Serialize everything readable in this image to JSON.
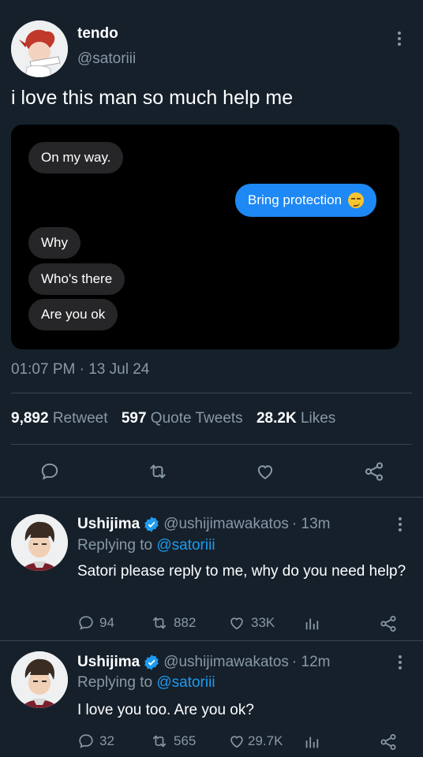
{
  "tweet": {
    "author_name": "tendo",
    "author_handle": "@satoriii",
    "text": "i love this man so much help me",
    "timestamp": "01:07 PM · 13 Jul 24",
    "stats": {
      "retweets_num": "9,892",
      "retweets_label": "Retweet",
      "quotes_num": "597",
      "quotes_label": "Quote Tweets",
      "likes_num": "28.2K",
      "likes_label": "Likes"
    }
  },
  "chat": {
    "msg1": "On my way.",
    "msg2": "Bring protection",
    "msg2_emoji": "😏",
    "msg3": "Why",
    "msg4": "Who's there",
    "msg5": "Are you ok"
  },
  "replies": [
    {
      "name": "Ushijima",
      "handle": "@ushijimawakatos",
      "time": "· 13m",
      "replying_label": "Replying to",
      "replying_to": "@satoriii",
      "text": "Satori please reply to me, why do you need help?",
      "replies": "94",
      "retweets": "882",
      "likes": "33K"
    },
    {
      "name": "Ushijima",
      "handle": "@ushijimawakatos",
      "time": "· 12m",
      "replying_label": "Replying to",
      "replying_to": "@satoriii",
      "text": "I love you too. Are you ok?",
      "replies": "32",
      "retweets": "565",
      "likes": "29.7K"
    }
  ],
  "colors": {
    "background": "#15202b",
    "muted": "#8899a6",
    "link": "#1d9bf0",
    "verified": "#1d9bf0",
    "imessage_blue": "#1e88f5",
    "imessage_gray": "#262628"
  },
  "icons": [
    "more-icon",
    "reply-icon",
    "retweet-icon",
    "like-icon",
    "share-icon",
    "analytics-icon",
    "verified-icon"
  ]
}
